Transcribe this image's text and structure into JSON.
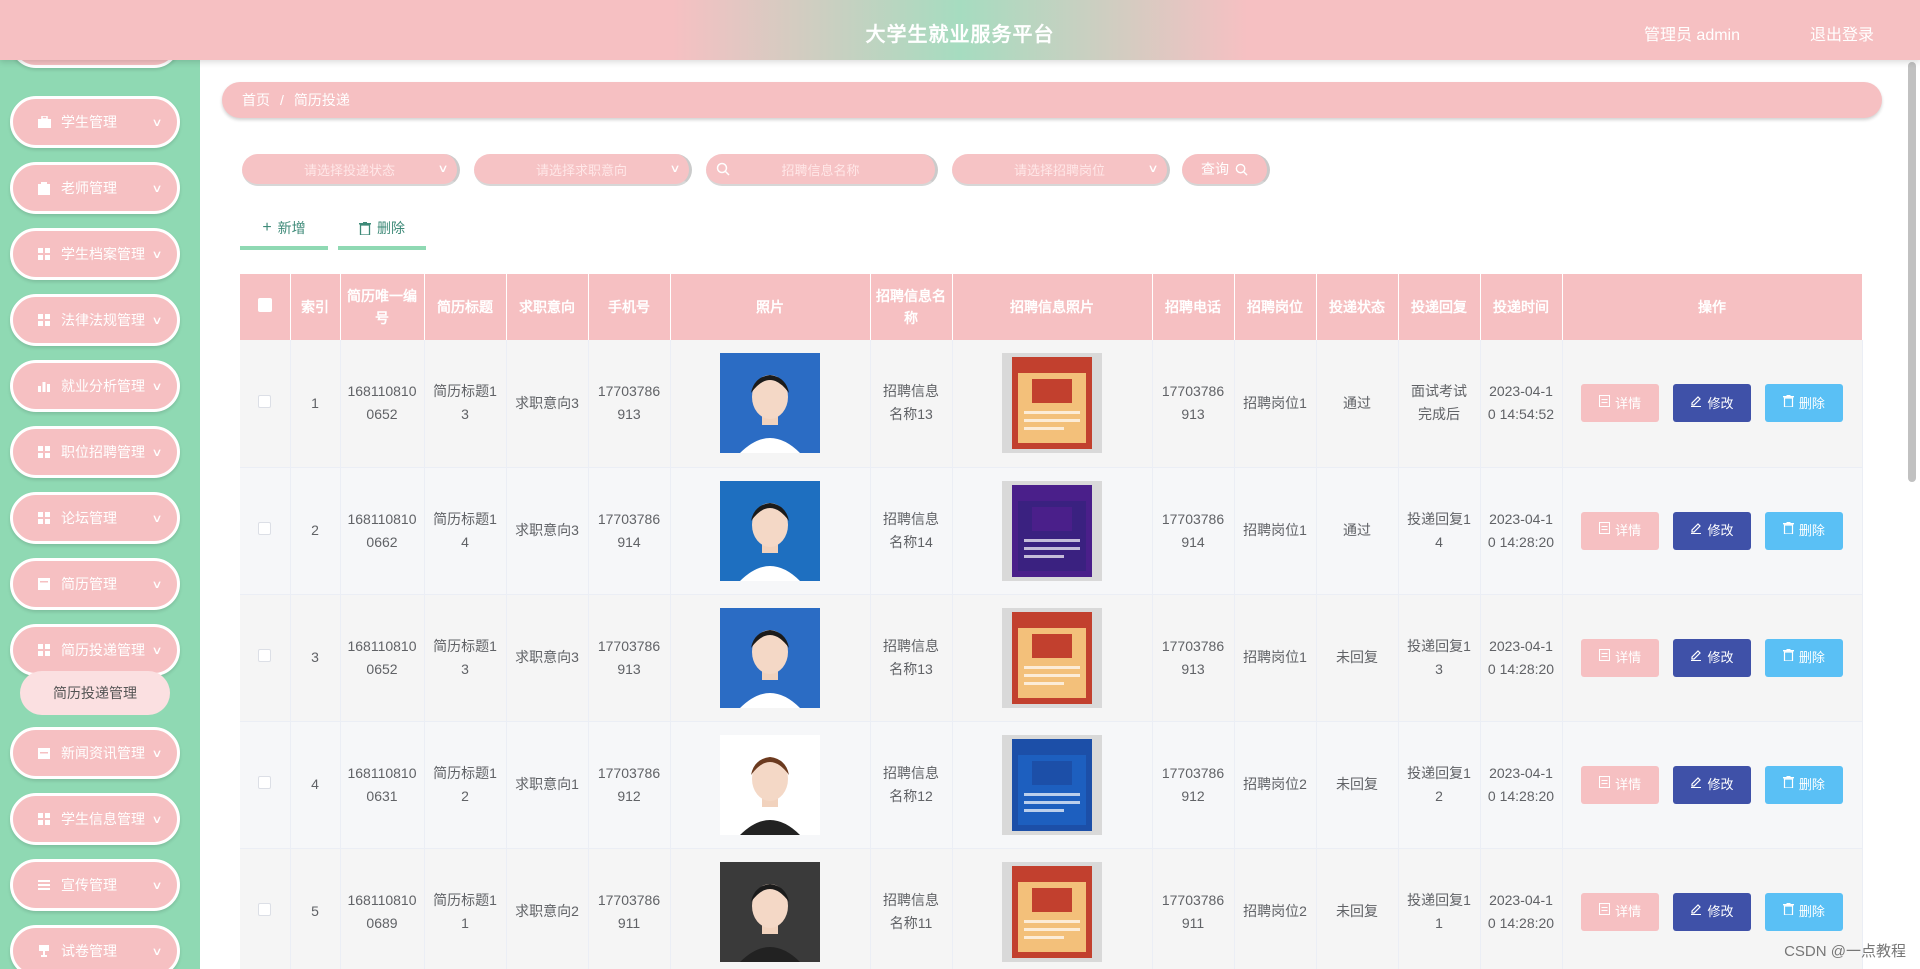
{
  "header": {
    "title": "大学生就业服务平台",
    "user": "管理员 admin",
    "logout": "退出登录"
  },
  "sidebar": {
    "items": [
      {
        "label": "",
        "icon": "user-icon"
      },
      {
        "label": "学生管理",
        "icon": "briefcase-icon"
      },
      {
        "label": "老师管理",
        "icon": "clipboard-icon"
      },
      {
        "label": "学生档案管理",
        "icon": "grid-icon"
      },
      {
        "label": "法律法规管理",
        "icon": "grid-icon"
      },
      {
        "label": "就业分析管理",
        "icon": "bar-chart-icon"
      },
      {
        "label": "职位招聘管理",
        "icon": "grid-icon"
      },
      {
        "label": "论坛管理",
        "icon": "grid-icon"
      },
      {
        "label": "简历管理",
        "icon": "document-icon"
      },
      {
        "label": "简历投递管理",
        "icon": "grid-icon"
      },
      {
        "label": "新闻资讯管理",
        "icon": "calendar-icon"
      },
      {
        "label": "学生信息管理",
        "icon": "grid-icon"
      },
      {
        "label": "宣传管理",
        "icon": "list-icon"
      },
      {
        "label": "试卷管理",
        "icon": "trophy-icon"
      }
    ],
    "active_sub": "简历投递管理"
  },
  "breadcrumb": {
    "home": "首页",
    "separator": "/",
    "current": "简历投递"
  },
  "filters": {
    "status_placeholder": "请选择投递状态",
    "intention_placeholder": "请选择求职意向",
    "name_placeholder": "招聘信息名称",
    "position_placeholder": "请选择招聘岗位",
    "query": "查询"
  },
  "actions": {
    "add": "新增",
    "delete": "删除"
  },
  "table": {
    "headers": [
      "索引",
      "简历唯一编号",
      "简历标题",
      "求职意向",
      "手机号",
      "照片",
      "招聘信息名称",
      "招聘信息照片",
      "招聘电话",
      "招聘岗位",
      "投递状态",
      "投递回复",
      "投递时间",
      "操作"
    ],
    "rows": [
      {
        "index": "1",
        "resume_no": "1681108100652",
        "title": "简历标题13",
        "intention": "求职意向3",
        "phone": "17703786913",
        "job_name": "招聘信息名称13",
        "job_phone": "17703786913",
        "position": "招聘岗位1",
        "status": "通过",
        "reply": "面试考试完成后",
        "time": "2023-04-10 14:54:52"
      },
      {
        "index": "2",
        "resume_no": "1681108100662",
        "title": "简历标题14",
        "intention": "求职意向3",
        "phone": "17703786914",
        "job_name": "招聘信息名称14",
        "job_phone": "17703786914",
        "position": "招聘岗位1",
        "status": "通过",
        "reply": "投递回复14",
        "time": "2023-04-10 14:28:20"
      },
      {
        "index": "3",
        "resume_no": "1681108100652",
        "title": "简历标题13",
        "intention": "求职意向3",
        "phone": "17703786913",
        "job_name": "招聘信息名称13",
        "job_phone": "17703786913",
        "position": "招聘岗位1",
        "status": "未回复",
        "reply": "投递回复13",
        "time": "2023-04-10 14:28:20"
      },
      {
        "index": "4",
        "resume_no": "1681108100631",
        "title": "简历标题12",
        "intention": "求职意向1",
        "phone": "17703786912",
        "job_name": "招聘信息名称12",
        "job_phone": "17703786912",
        "position": "招聘岗位2",
        "status": "未回复",
        "reply": "投递回复12",
        "time": "2023-04-10 14:28:20"
      },
      {
        "index": "5",
        "resume_no": "1681108100689",
        "title": "简历标题11",
        "intention": "求职意向2",
        "phone": "17703786911",
        "job_name": "招聘信息名称11",
        "job_phone": "17703786911",
        "position": "招聘岗位2",
        "status": "未回复",
        "reply": "投递回复11",
        "time": "2023-04-10 14:28:20"
      }
    ],
    "buttons": {
      "detail": "详情",
      "edit": "修改",
      "delete": "删除"
    }
  },
  "watermark": "CSDN @一点教程",
  "colors": {
    "accent_pink": "#f6c0c2",
    "sidebar_green": "#8fd9b3",
    "edit_blue": "#3f51a8",
    "delete_blue": "#5ac0f5"
  }
}
